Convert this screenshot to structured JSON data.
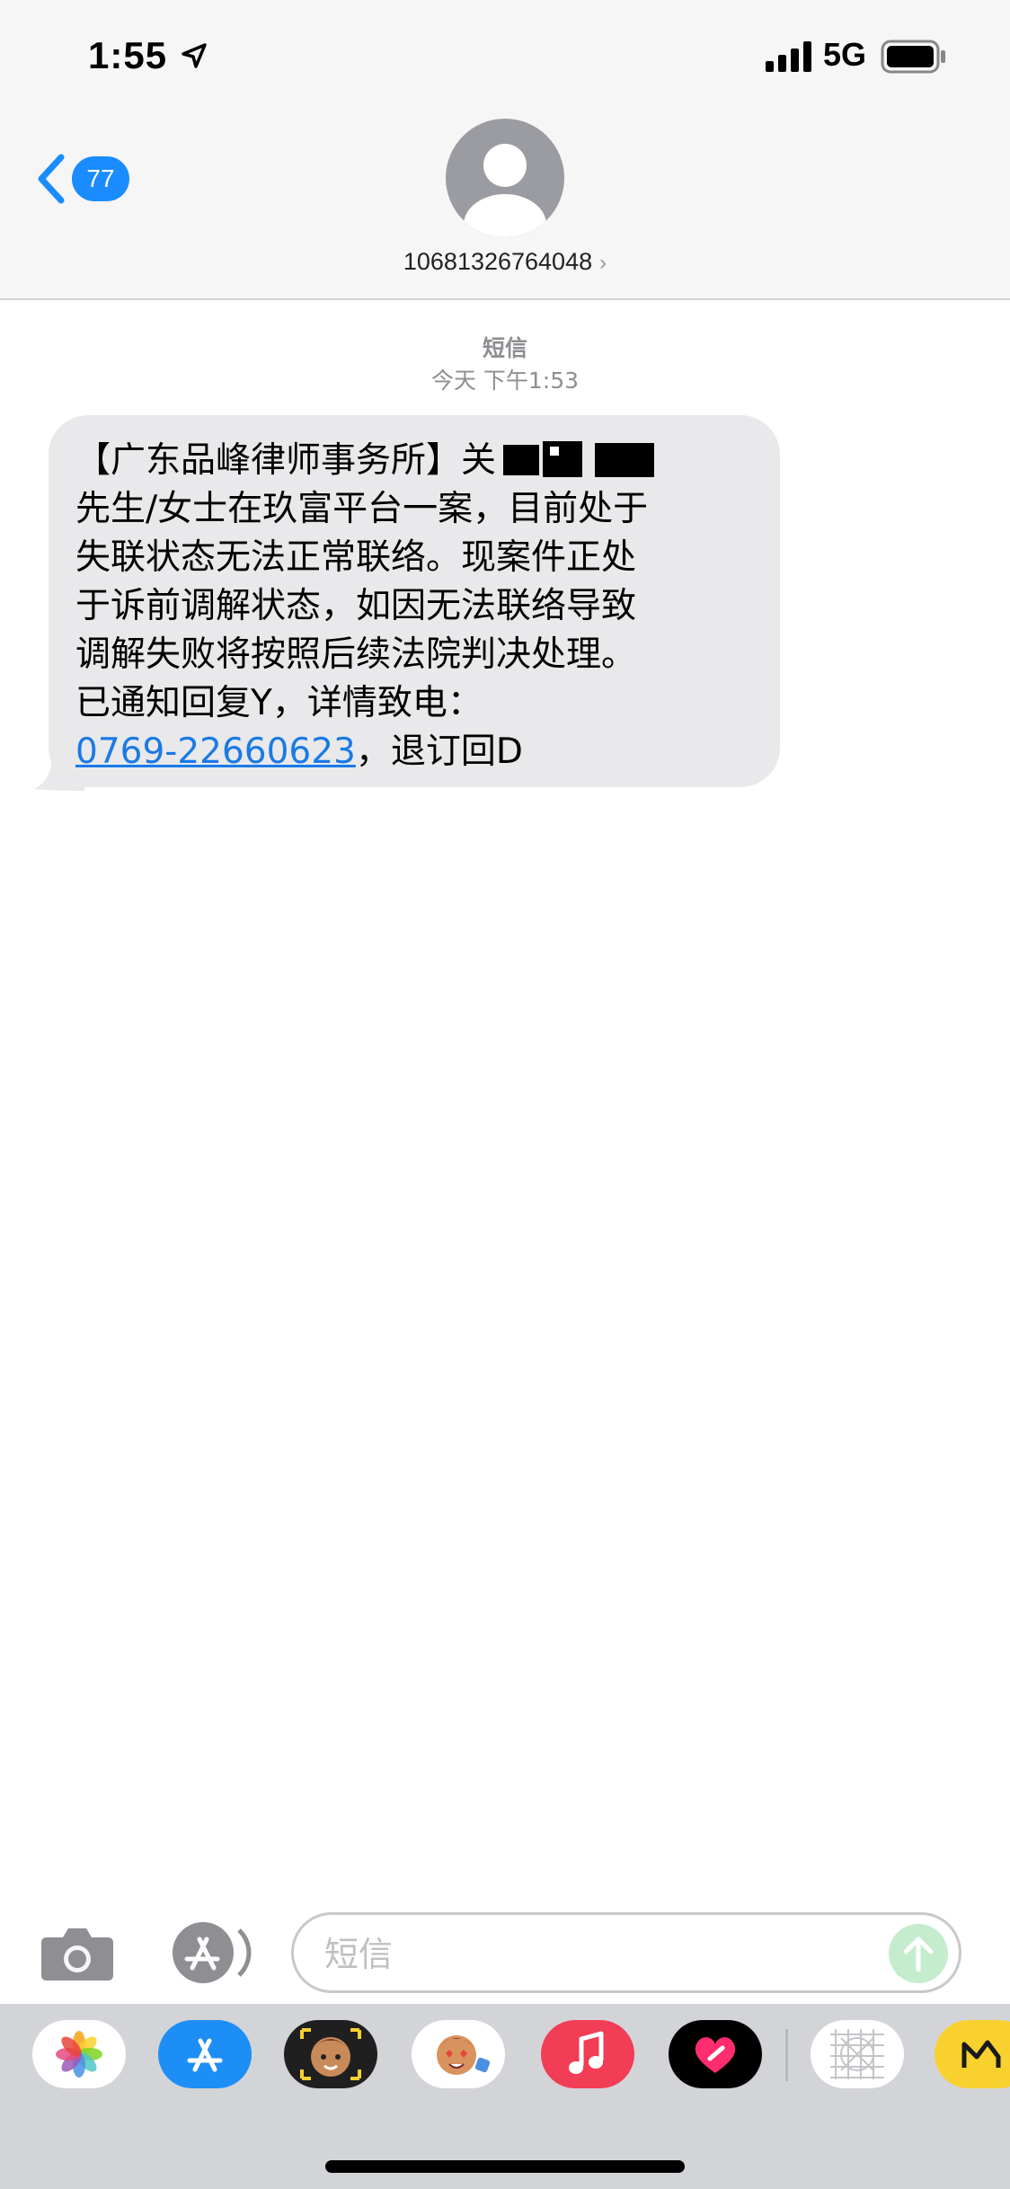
{
  "status_bar": {
    "time": "1:55",
    "network": "5G"
  },
  "header": {
    "back_badge": "77",
    "contact_name": "10681326764048",
    "chevron": "›"
  },
  "conversation": {
    "service": "短信",
    "timestamp": "今天 下午1:53",
    "message": {
      "line1": "【广东品峰律师事务所】关",
      "line2": "先生/女士在玖富平台一案，目前处于",
      "line3": "失联状态无法正常联络。现案件正处",
      "line4": "于诉前调解状态，如因无法联络导致",
      "line5": "调解失败将按照后续法院判决处理。",
      "line6": "已通知回复Y，详情致电：",
      "phone": "0769-22660623",
      "suffix": "，退订回D"
    }
  },
  "compose": {
    "placeholder": "短信"
  },
  "drawer": {
    "apps": [
      "photos-icon",
      "app-store-icon",
      "memoji-camera-icon",
      "memoji-stickers-icon",
      "music-icon",
      "digital-touch-icon",
      "grid-app-icon",
      "yellow-app-icon"
    ]
  },
  "colors": {
    "accent": "#1a8cff",
    "bubble": "#e9e9eb",
    "link": "#1a7ae6"
  }
}
